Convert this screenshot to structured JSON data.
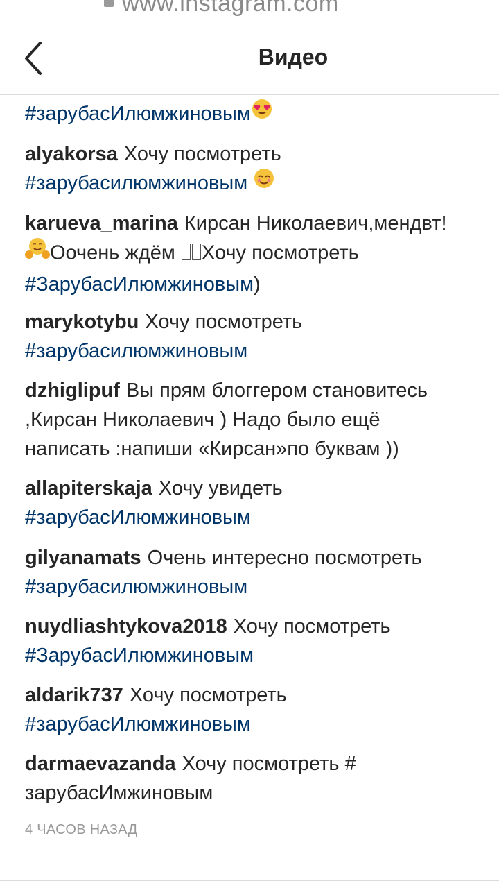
{
  "browser": {
    "url": "www.instagram.com"
  },
  "header": {
    "title": "Видео"
  },
  "comments": [
    {
      "user": "",
      "line1_tag": "#зарубасИлюмжиновым"
    },
    {
      "user": "alyakorsa",
      "line1_text": "Хочу посмотреть",
      "line2_tag": "#зарубасилюмжиновым"
    },
    {
      "user": "karueva_marina",
      "line1_text": "Кирсан Николаевич,мендвт!",
      "line2_text": "Оочень ждём ",
      "line2_text_b": "Хочу посмотреть",
      "line3_tag": "#ЗарубасИлюмжиновым",
      "line3_suffix": ")"
    },
    {
      "user": "marykotybu",
      "line1_text": "Хочу посмотреть",
      "line2_tag": "#зарубасилюмжиновым"
    },
    {
      "user": "dzhiglipuf",
      "line1_text": "Вы прям блоггером становитесь",
      "line2_text": ",Кирсан Николаевич ) Надо было ещё",
      "line3_text": "написать :напиши «Кирсан»по буквам ))"
    },
    {
      "user": "allapiterskaja",
      "line1_text": "Хочу увидеть",
      "line2_tag": "#зарубасИлюмжиновым"
    },
    {
      "user": "gilyanamats",
      "line1_text": "Очень интересно посмотреть",
      "line2_tag": "#зарубасилюмжиновым"
    },
    {
      "user": "nuydliashtykova2018",
      "line1_text": "Хочу посмотреть",
      "line2_tag": "#ЗарубасИлюмжиновым"
    },
    {
      "user": "aldarik737",
      "line1_text": "Хочу посмотреть",
      "line2_tag": "#зарубасИлюмжиновым"
    },
    {
      "user": "darmaevazanda",
      "line1_text": "Хочу посмотреть #",
      "line2_text": "зарубасИмжиновым"
    }
  ],
  "timestamp": "4 ЧАСОВ НАЗАД",
  "icons": {
    "back": "chevron-left-icon",
    "heart_eyes": "heart-eyes-emoji",
    "smiling": "smiling-face-emoji",
    "hugging": "hugging-face-emoji"
  },
  "colors": {
    "text": "#262626",
    "hashtag": "#003569",
    "timestamp": "#999999",
    "divider": "#dbdbdb"
  }
}
